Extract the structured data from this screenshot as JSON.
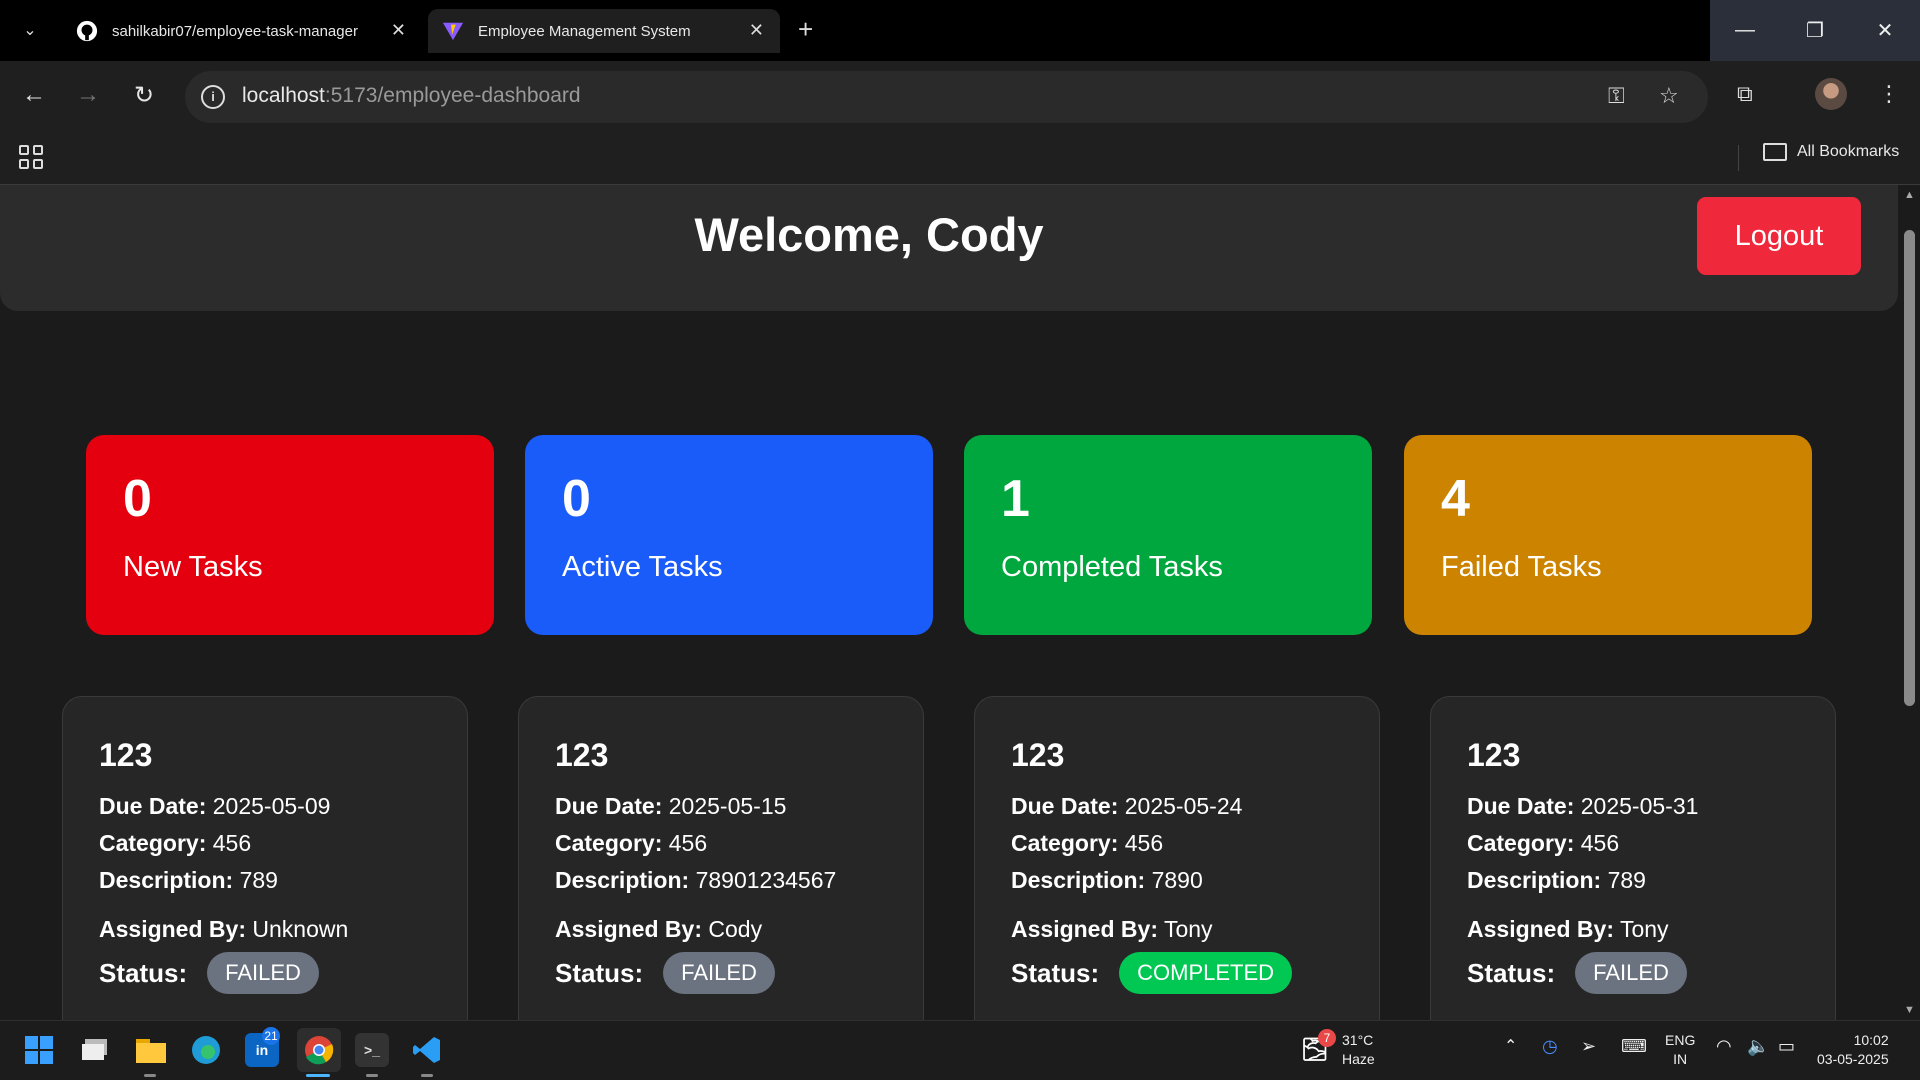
{
  "browser": {
    "tabs": [
      {
        "title": "sahilkabir07/employee-task-manager",
        "icon": "github-icon"
      },
      {
        "title": "Employee Management System",
        "icon": "vite-icon"
      }
    ],
    "new_tab": "+",
    "url_host": "localhost",
    "url_path": ":5173/employee-dashboard",
    "bookmarks_label": "All Bookmarks"
  },
  "header": {
    "welcome": "Welcome, Cody",
    "logout_label": "Logout"
  },
  "stats": [
    {
      "count": "0",
      "label": "New Tasks",
      "color": "#e5000f"
    },
    {
      "count": "0",
      "label": "Active Tasks",
      "color": "#1a5cf9"
    },
    {
      "count": "1",
      "label": "Completed Tasks",
      "color": "#00a73e"
    },
    {
      "count": "4",
      "label": "Failed Tasks",
      "color": "#cc8400"
    }
  ],
  "labels": {
    "due": "Due Date:",
    "category": "Category:",
    "description": "Description:",
    "assigned": "Assigned By:",
    "status": "Status:"
  },
  "tasks": [
    {
      "title": "123",
      "due": "2025-05-09",
      "category": "456",
      "description": "789",
      "assigned_by": "Unknown",
      "status": "FAILED"
    },
    {
      "title": "123",
      "due": "2025-05-15",
      "category": "456",
      "description": "78901234567",
      "assigned_by": "Cody",
      "status": "FAILED"
    },
    {
      "title": "123",
      "due": "2025-05-24",
      "category": "456",
      "description": "7890",
      "assigned_by": "Tony",
      "status": "COMPLETED"
    },
    {
      "title": "123",
      "due": "2025-05-31",
      "category": "456",
      "description": "789",
      "assigned_by": "Tony",
      "status": "FAILED"
    }
  ],
  "taskbar": {
    "weather_temp": "31°C",
    "weather_desc": "Haze",
    "weather_badge": "7",
    "linkedin_badge": "21",
    "lang": "ENG",
    "region": "IN",
    "time": "10:02",
    "date": "03-05-2025"
  }
}
